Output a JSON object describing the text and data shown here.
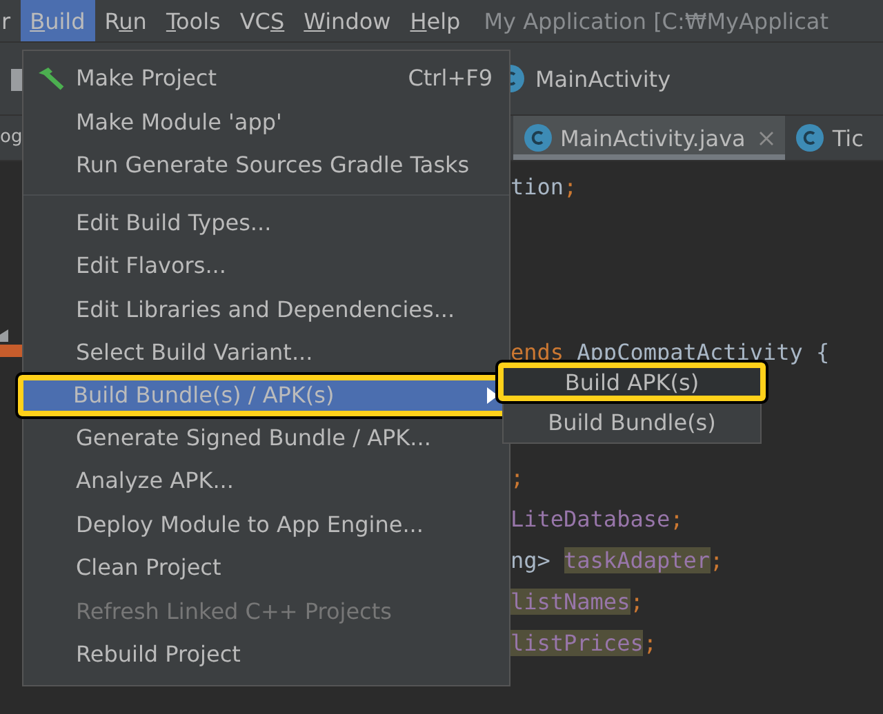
{
  "menubar": {
    "items": [
      {
        "label": {
          "post": "r"
        },
        "selected": false
      },
      {
        "label": {
          "key": "B",
          "post": "uild"
        },
        "selected": true
      },
      {
        "label": {
          "pre": "R",
          "key": "u",
          "post": "n"
        },
        "selected": false
      },
      {
        "label": {
          "key": "T",
          "post": "ools"
        },
        "selected": false
      },
      {
        "label": {
          "pre": "VC",
          "key": "S"
        },
        "selected": false
      },
      {
        "label": {
          "key": "W",
          "post": "indow"
        },
        "selected": false
      },
      {
        "label": {
          "key": "H",
          "post": "elp"
        },
        "selected": false
      }
    ],
    "title": "My Application [C:₩MyApplicat"
  },
  "breadcrumb": {
    "label": "MainActivity"
  },
  "tabs": [
    {
      "label": "og",
      "selected": false,
      "kind": "plain"
    },
    {
      "label": "MainActivity.java",
      "selected": true,
      "kind": "class"
    },
    {
      "label": "Tic",
      "selected": false,
      "kind": "class"
    }
  ],
  "editor": {
    "lines": [
      {
        "kind": "code",
        "tokens": [
          {
            "text": "tion",
            "kind": "plain"
          },
          {
            "text": ";",
            "kind": "punct"
          }
        ]
      },
      {
        "kind": "blank"
      },
      {
        "kind": "blank"
      },
      {
        "kind": "blank"
      },
      {
        "kind": "code",
        "tokens": [
          {
            "text": "ends",
            "kind": "keyword"
          },
          {
            "text": " AppCompatActivity {",
            "kind": "plain"
          }
        ]
      },
      {
        "kind": "blank"
      },
      {
        "kind": "blank"
      },
      {
        "kind": "code",
        "tokens": [
          {
            "text": ";",
            "kind": "punct"
          }
        ]
      },
      {
        "kind": "code",
        "tokens": [
          {
            "text": "LiteDatabase",
            "kind": "field"
          },
          {
            "text": ";",
            "kind": "punct"
          }
        ]
      },
      {
        "kind": "code",
        "tokens": [
          {
            "text": "ng> ",
            "kind": "plain"
          },
          {
            "text": "taskAdapter",
            "kind": "highlighted"
          },
          {
            "text": ";",
            "kind": "punct"
          }
        ]
      },
      {
        "kind": "code",
        "tokens": [
          {
            "text": "listNames",
            "kind": "highlighted"
          },
          {
            "text": ";",
            "kind": "punct"
          }
        ]
      },
      {
        "kind": "code",
        "tokens": [
          {
            "text": "listPrices",
            "kind": "highlighted"
          },
          {
            "text": ";",
            "kind": "punct"
          }
        ]
      }
    ]
  },
  "build_menu": {
    "items": [
      {
        "kind": "build_item",
        "label": "Make Project",
        "shortcut": "Ctrl+F9",
        "disabled": false,
        "selected": false,
        "submenu": false,
        "annotated": false
      },
      {
        "kind": "item",
        "label": "Make Module 'app'",
        "disabled": false,
        "selected": false,
        "submenu": false,
        "annotated": false
      },
      {
        "kind": "item",
        "label": "Run Generate Sources Gradle Tasks",
        "disabled": false,
        "selected": false,
        "submenu": false,
        "annotated": false
      },
      {
        "kind": "separator"
      },
      {
        "kind": "item",
        "label": "Edit Build Types...",
        "disabled": false,
        "selected": false,
        "submenu": false,
        "annotated": false
      },
      {
        "kind": "item",
        "label": "Edit Flavors...",
        "disabled": false,
        "selected": false,
        "submenu": false,
        "annotated": false
      },
      {
        "kind": "item",
        "label": "Edit Libraries and Dependencies...",
        "disabled": false,
        "selected": false,
        "submenu": false,
        "annotated": false
      },
      {
        "kind": "item",
        "label": "Select Build Variant...",
        "disabled": false,
        "selected": false,
        "submenu": false,
        "annotated": false
      },
      {
        "kind": "item",
        "label": "Build Bundle(s) / APK(s)",
        "disabled": false,
        "selected": true,
        "submenu": true,
        "annotated": true
      },
      {
        "kind": "item",
        "label": "Generate Signed Bundle / APK...",
        "disabled": false,
        "selected": false,
        "submenu": false,
        "annotated": false
      },
      {
        "kind": "item",
        "label": "Analyze APK...",
        "disabled": false,
        "selected": false,
        "submenu": false,
        "annotated": false
      },
      {
        "kind": "item",
        "label": "Deploy Module to App Engine...",
        "disabled": false,
        "selected": false,
        "submenu": false,
        "annotated": false
      },
      {
        "kind": "item",
        "label": "Clean Project",
        "disabled": false,
        "selected": false,
        "submenu": false,
        "annotated": false
      },
      {
        "kind": "item",
        "label": "Refresh Linked C++ Projects",
        "disabled": true,
        "selected": false,
        "submenu": false,
        "annotated": false
      },
      {
        "kind": "item",
        "label": "Rebuild Project",
        "disabled": false,
        "selected": false,
        "submenu": false,
        "annotated": false
      }
    ]
  },
  "submenu": {
    "items": [
      {
        "label": "Build APK(s)",
        "selected": true,
        "annotated": true
      },
      {
        "label": "Build Bundle(s)",
        "selected": false,
        "annotated": false
      }
    ]
  }
}
